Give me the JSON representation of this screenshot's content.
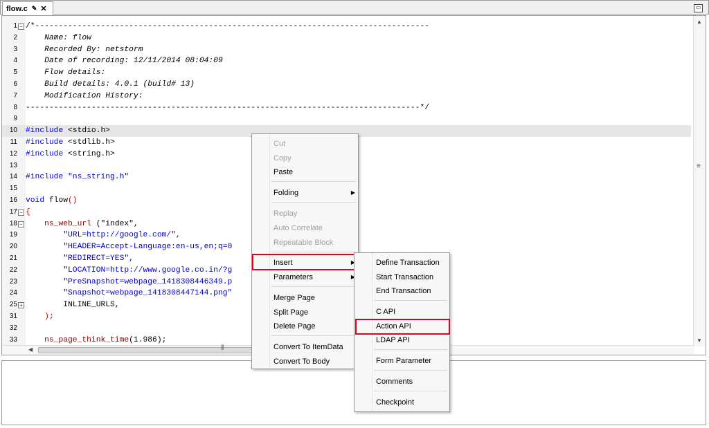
{
  "tab": {
    "title": "flow.c",
    "pin_icon": "pin-icon",
    "close_icon": "close-icon"
  },
  "editor": {
    "lines": [
      {
        "n": "1",
        "fold": "−",
        "text": "/*------------------------------------------------------------------------------------"
      },
      {
        "n": "2",
        "fold": "",
        "text": "    Name: flow"
      },
      {
        "n": "3",
        "fold": "",
        "text": "    Recorded By: netstorm"
      },
      {
        "n": "4",
        "fold": "",
        "text": "    Date of recording: 12/11/2014 08:04:09"
      },
      {
        "n": "5",
        "fold": "",
        "text": "    Flow details:"
      },
      {
        "n": "6",
        "fold": "",
        "text": "    Build details: 4.0.1 (build# 13)"
      },
      {
        "n": "7",
        "fold": "",
        "text": "    Modification History:"
      },
      {
        "n": "8",
        "fold": "",
        "text": "------------------------------------------------------------------------------------*/"
      },
      {
        "n": "9",
        "fold": "",
        "text": ""
      },
      {
        "n": "10",
        "fold": "",
        "text_a": "#include",
        "text_b": " <stdio.h>"
      },
      {
        "n": "11",
        "fold": "",
        "text_a": "#include",
        "text_b": " <stdlib.h>"
      },
      {
        "n": "12",
        "fold": "",
        "text_a": "#include",
        "text_b": " <string.h>"
      },
      {
        "n": "13",
        "fold": "",
        "text": ""
      },
      {
        "n": "14",
        "fold": "",
        "text_a": "#include",
        "text_b": " \"ns_string.h\""
      },
      {
        "n": "15",
        "fold": "",
        "text": ""
      },
      {
        "n": "16",
        "fold": "",
        "text_a": "void",
        "text_b": " flow",
        "text_c": "()"
      },
      {
        "n": "17",
        "fold": "−",
        "text": "{"
      },
      {
        "n": "18",
        "fold": "−",
        "text_a": "    ns_web_url",
        "text_b": " (\"index\","
      },
      {
        "n": "19",
        "fold": "",
        "text": "        \"URL=http://google.com/\","
      },
      {
        "n": "20",
        "fold": "",
        "text": "        \"HEADER=Accept-Language:en-us,en;q=0"
      },
      {
        "n": "21",
        "fold": "",
        "text": "        \"REDIRECT=YES\","
      },
      {
        "n": "22",
        "fold": "",
        "text": "        \"LOCATION=http://www.google.co.in/?g"
      },
      {
        "n": "23",
        "fold": "",
        "text": "        \"PreSnapshot=webpage_1418308446349.p"
      },
      {
        "n": "24",
        "fold": "",
        "text": "        \"Snapshot=webpage_1418308447144.png\""
      },
      {
        "n": "25",
        "fold": "+",
        "text": "        INLINE_URLS,"
      },
      {
        "n": "31",
        "fold": "",
        "text": "    );"
      },
      {
        "n": "32",
        "fold": "",
        "text": ""
      },
      {
        "n": "33",
        "fold": "",
        "text_a": "    ns_page_think_time",
        "text_b": "(1.986);"
      }
    ]
  },
  "context_menu": {
    "cut": "Cut",
    "copy": "Copy",
    "paste": "Paste",
    "folding": "Folding",
    "replay": "Replay",
    "auto_correlate": "Auto Correlate",
    "repeatable_block": "Repeatable Block",
    "insert": "Insert",
    "parameters": "Parameters",
    "merge_page": "Merge Page",
    "split_page": "Split Page",
    "delete_page": "Delete Page",
    "convert_itemdata": "Convert To ItemData",
    "convert_body": "Convert To Body"
  },
  "insert_submenu": {
    "define_transaction": "Define Transaction",
    "start_transaction": "Start Transaction",
    "end_transaction": "End Transaction",
    "c_api": "C API",
    "action_api": "Action API",
    "ldap_api": "LDAP API",
    "form_parameter": "Form Parameter",
    "comments": "Comments",
    "checkpoint": "Checkpoint"
  },
  "colors": {
    "highlight_box": "#e3001b",
    "keyword": "#0000ee",
    "function": "#880000"
  }
}
